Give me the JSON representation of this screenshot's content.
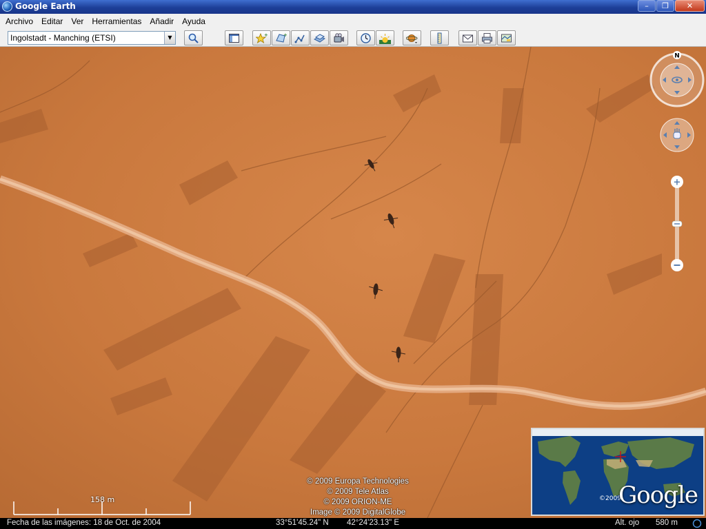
{
  "window": {
    "title": "Google Earth"
  },
  "menu": [
    "Archivo",
    "Editar",
    "Ver",
    "Herramientas",
    "Añadir",
    "Ayuda"
  ],
  "search": {
    "value": "Ingolstadt - Manching (ETSI)"
  },
  "map": {
    "credits": [
      "© 2009 Europa Technologies",
      "© 2009 Tele Atlas",
      "© 2009 ORION-ME",
      "Image © 2009 DigitalGlobe"
    ],
    "scale_label": "158 m",
    "compass_north": "N"
  },
  "overview": {
    "year": "©2009",
    "brand": "Google"
  },
  "status": {
    "imagery_date": "Fecha de las imágenes: 18 de Oct. de 2004",
    "latitude": "33°51'45.24\" N",
    "longitude": "42°24'23.13\" E",
    "eye_alt_label": "Alt. ojo",
    "eye_alt_value": "580 m"
  }
}
